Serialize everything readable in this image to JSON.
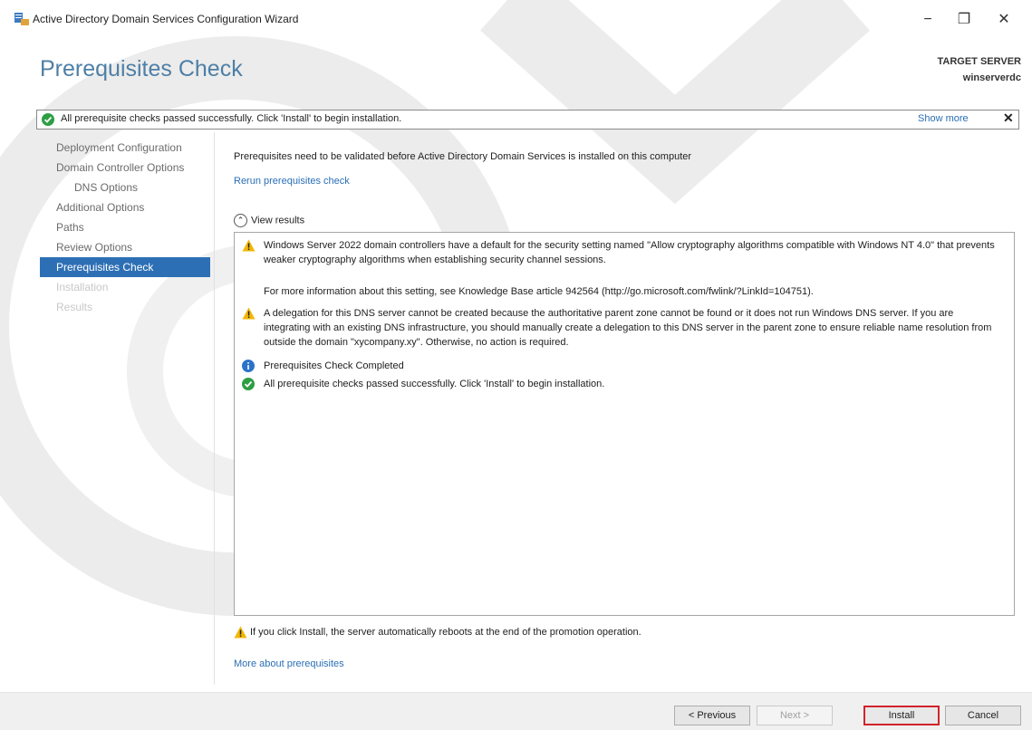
{
  "window": {
    "title": "Active Directory Domain Services Configuration Wizard",
    "minimize": "−",
    "restore": "❐",
    "close": "✕"
  },
  "header": {
    "page_title": "Prerequisites Check",
    "target_label": "TARGET SERVER",
    "target_name": "winserverdc"
  },
  "notice": {
    "text": "All prerequisite checks passed successfully.  Click 'Install' to begin installation.",
    "show_more": "Show more",
    "close": "✕"
  },
  "nav": {
    "items": [
      {
        "label": "Deployment Configuration"
      },
      {
        "label": "Domain Controller Options"
      },
      {
        "label": "DNS Options"
      },
      {
        "label": "Additional Options"
      },
      {
        "label": "Paths"
      },
      {
        "label": "Review Options"
      },
      {
        "label": "Prerequisites Check"
      },
      {
        "label": "Installation"
      },
      {
        "label": "Results"
      }
    ]
  },
  "main": {
    "intro": "Prerequisites need to be validated before Active Directory Domain Services is installed on this computer",
    "rerun": "Rerun prerequisites check",
    "view_results": "View results",
    "results": [
      {
        "icon": "warning-icon",
        "text": "Windows Server 2022 domain controllers have a default for the security setting named \"Allow cryptography algorithms compatible with Windows NT 4.0\" that prevents weaker cryptography algorithms when establishing security channel sessions."
      },
      {
        "icon": "",
        "text": "For more information about this setting, see Knowledge Base article 942564 (http://go.microsoft.com/fwlink/?LinkId=104751)."
      },
      {
        "icon": "warning-icon",
        "text": "A delegation for this DNS server cannot be created because the authoritative parent zone cannot be found or it does not run Windows DNS server. If you are integrating with an existing DNS infrastructure, you should manually create a delegation to this DNS server in the parent zone to ensure reliable name resolution from outside the domain \"xycompany.xy\". Otherwise, no action is required."
      },
      {
        "icon": "info-icon",
        "text": "Prerequisites Check Completed"
      },
      {
        "icon": "success-icon",
        "text": "All prerequisite checks passed successfully.  Click 'Install' to begin installation."
      }
    ],
    "footer_warning": "If you click Install, the server automatically reboots at the end of the promotion operation.",
    "more_link": "More about prerequisites"
  },
  "buttons": {
    "previous": "< Previous",
    "next": "Next >",
    "install": "Install",
    "cancel": "Cancel"
  },
  "colors": {
    "accent": "#2d6fb5",
    "title_blue": "#4e7fa6",
    "warning": "#f2b705",
    "success": "#2e9e44",
    "info": "#2b73c9",
    "install_highlight": "#d2232a"
  }
}
